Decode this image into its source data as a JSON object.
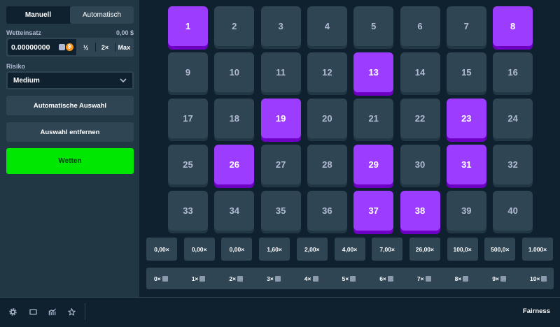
{
  "sidebar": {
    "tabs": [
      "Manuell",
      "Automatisch"
    ],
    "bet_label": "Wetteinsatz",
    "bet_amount_display": "0,00 $",
    "bet_value": "0.00000000",
    "bet_buttons": [
      "½",
      "2×",
      "Max"
    ],
    "risk_label": "Risiko",
    "risk_value": "Medium",
    "auto_pick": "Automatische Auswahl",
    "clear": "Auswahl entfernen",
    "play": "Wetten"
  },
  "grid": {
    "tiles": [
      "1",
      "2",
      "3",
      "4",
      "5",
      "6",
      "7",
      "8",
      "9",
      "10",
      "11",
      "12",
      "13",
      "14",
      "15",
      "16",
      "17",
      "18",
      "19",
      "20",
      "21",
      "22",
      "23",
      "24",
      "25",
      "26",
      "27",
      "28",
      "29",
      "30",
      "31",
      "32",
      "33",
      "34",
      "35",
      "36",
      "37",
      "38",
      "39",
      "40"
    ],
    "selected": [
      "1",
      "8",
      "13",
      "19",
      "23",
      "26",
      "29",
      "31",
      "37",
      "38"
    ]
  },
  "multipliers": [
    "0,00×",
    "0,00×",
    "0,00×",
    "1,60×",
    "2,00×",
    "4,00×",
    "7,00×",
    "26,00×",
    "100,0×",
    "500,0×",
    "1.000×"
  ],
  "hits": [
    "0×",
    "1×",
    "2×",
    "3×",
    "4×",
    "5×",
    "6×",
    "7×",
    "8×",
    "9×",
    "10×"
  ],
  "footer": {
    "fairness": "Fairness",
    "icons": [
      "settings-icon",
      "theater-icon",
      "stats-icon",
      "star-icon"
    ]
  },
  "colors": {
    "selected_tile": "#9b3cff",
    "tile": "#2f4553",
    "play_button": "#00e701",
    "background": "#0f212e",
    "sidebar": "#213743"
  }
}
